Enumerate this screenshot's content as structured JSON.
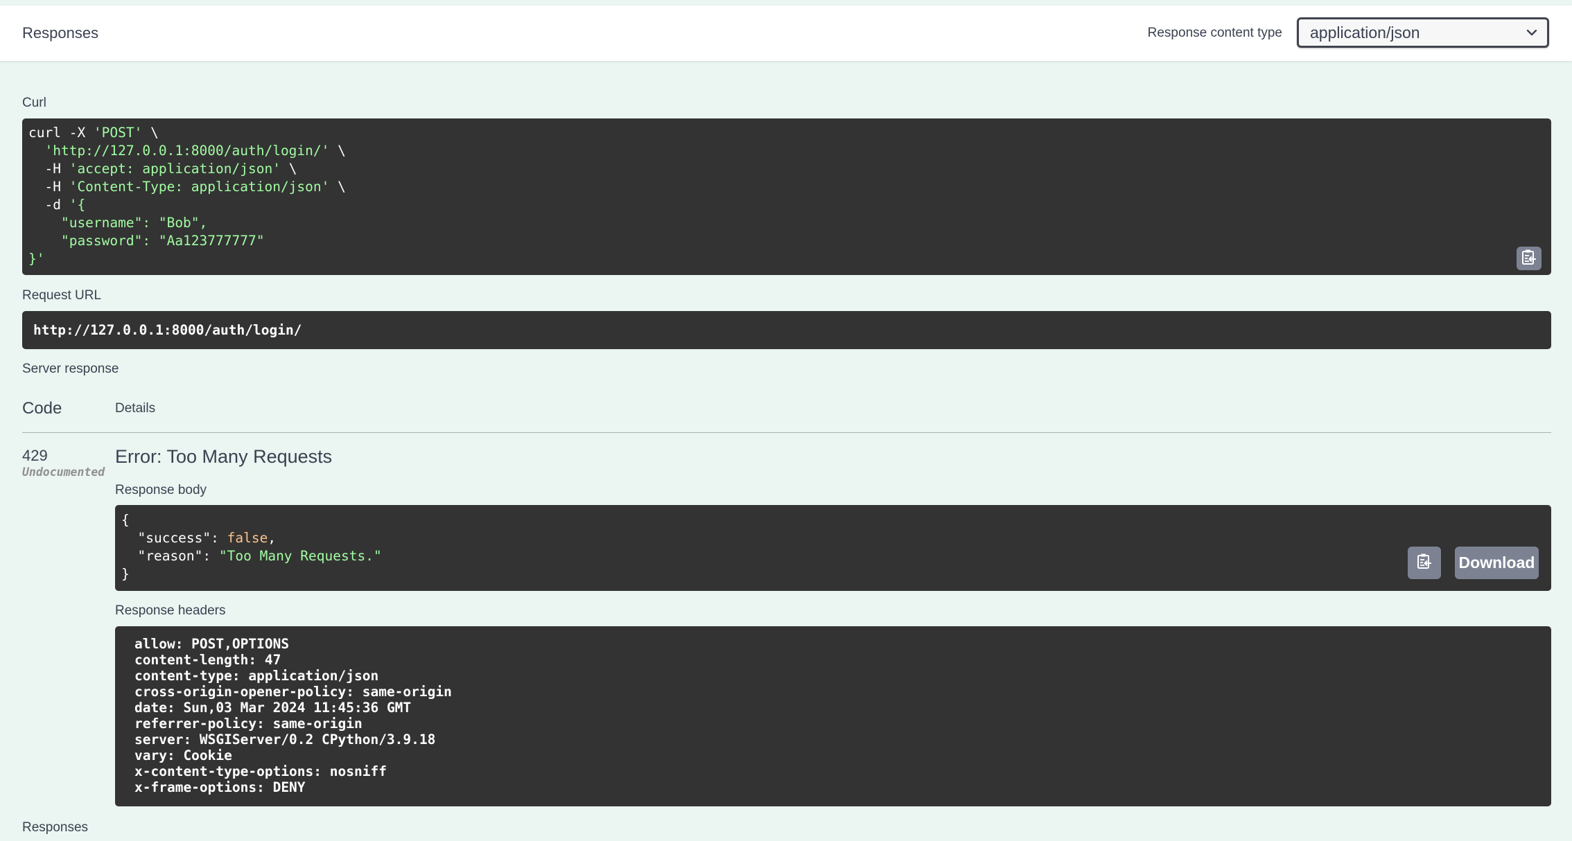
{
  "header": {
    "title": "Responses",
    "content_type_label": "Response content type",
    "content_type_value": "application/json"
  },
  "curl": {
    "label": "Curl",
    "lines": [
      [
        {
          "t": "curl -X ",
          "c": "w"
        },
        {
          "t": "'POST'",
          "c": "g"
        },
        {
          "t": " \\",
          "c": "w"
        }
      ],
      [
        {
          "t": "  ",
          "c": "w"
        },
        {
          "t": "'http://127.0.0.1:8000/auth/login/'",
          "c": "g"
        },
        {
          "t": " \\",
          "c": "w"
        }
      ],
      [
        {
          "t": "  -H ",
          "c": "w"
        },
        {
          "t": "'accept: application/json'",
          "c": "g"
        },
        {
          "t": " \\",
          "c": "w"
        }
      ],
      [
        {
          "t": "  -H ",
          "c": "w"
        },
        {
          "t": "'Content-Type: application/json'",
          "c": "g"
        },
        {
          "t": " \\",
          "c": "w"
        }
      ],
      [
        {
          "t": "  -d ",
          "c": "w"
        },
        {
          "t": "'{",
          "c": "g"
        }
      ],
      [
        {
          "t": "    \"username\": \"Bob\",",
          "c": "g"
        }
      ],
      [
        {
          "t": "    \"password\": \"Aa123777777\"",
          "c": "g"
        }
      ],
      [
        {
          "t": "}'",
          "c": "g"
        }
      ]
    ],
    "copy_icon": "clipboard-copy-icon"
  },
  "request_url": {
    "label": "Request URL",
    "value": "http://127.0.0.1:8000/auth/login/"
  },
  "server_response": {
    "label": "Server response",
    "code_header": "Code",
    "details_header": "Details",
    "status_code": "429",
    "status_note": "Undocumented",
    "error_title": "Error: Too Many Requests",
    "response_body_label": "Response body",
    "response_body_lines": [
      [
        {
          "t": "{",
          "c": "w"
        }
      ],
      [
        {
          "t": "  \"success\": ",
          "c": "w"
        },
        {
          "t": "false",
          "c": "o"
        },
        {
          "t": ",",
          "c": "w"
        }
      ],
      [
        {
          "t": "  \"reason\": ",
          "c": "w"
        },
        {
          "t": "\"Too Many Requests.\"",
          "c": "g"
        }
      ],
      [
        {
          "t": "}",
          "c": "w"
        }
      ]
    ],
    "download_label": "Download",
    "response_headers_label": "Response headers",
    "response_headers": [
      "allow: POST,OPTIONS",
      "content-length: 47",
      "content-type: application/json",
      "cross-origin-opener-policy: same-origin",
      "date: Sun,03 Mar 2024 11:45:36 GMT",
      "referrer-policy: same-origin",
      "server: WSGIServer/0.2 CPython/3.9.18",
      "vary: Cookie",
      "x-content-type-options: nosniff",
      "x-frame-options: DENY"
    ]
  },
  "footer": {
    "responses_label": "Responses"
  },
  "colors": {
    "page_bg": "#ebf5f1",
    "code_bg": "#333333",
    "string_green": "#a2fca2",
    "literal_orange": "#fcc28c",
    "button_gray": "#7d8293"
  }
}
